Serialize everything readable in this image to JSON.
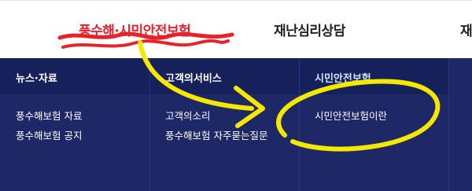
{
  "topnav": {
    "items": [
      "풍수해·시민안전보험",
      "재난심리상담",
      "재"
    ],
    "active_color": "#e8222b"
  },
  "mega_menu": {
    "columns": [
      {
        "heading": "뉴스·자료",
        "links": [
          "풍수해보험 자료",
          "풍수해보험 공지"
        ]
      },
      {
        "heading": "고객의서비스",
        "links": [
          "고객의소리",
          "풍수해보험 자주묻는질문"
        ]
      },
      {
        "heading": "시민안전보험",
        "links": [
          "시민안전보험이란"
        ]
      }
    ],
    "background": "#1e2867",
    "header_background": "#16205b"
  },
  "annotations": {
    "underline_color": "#e8222b",
    "arrow_color": "#f5e800"
  }
}
